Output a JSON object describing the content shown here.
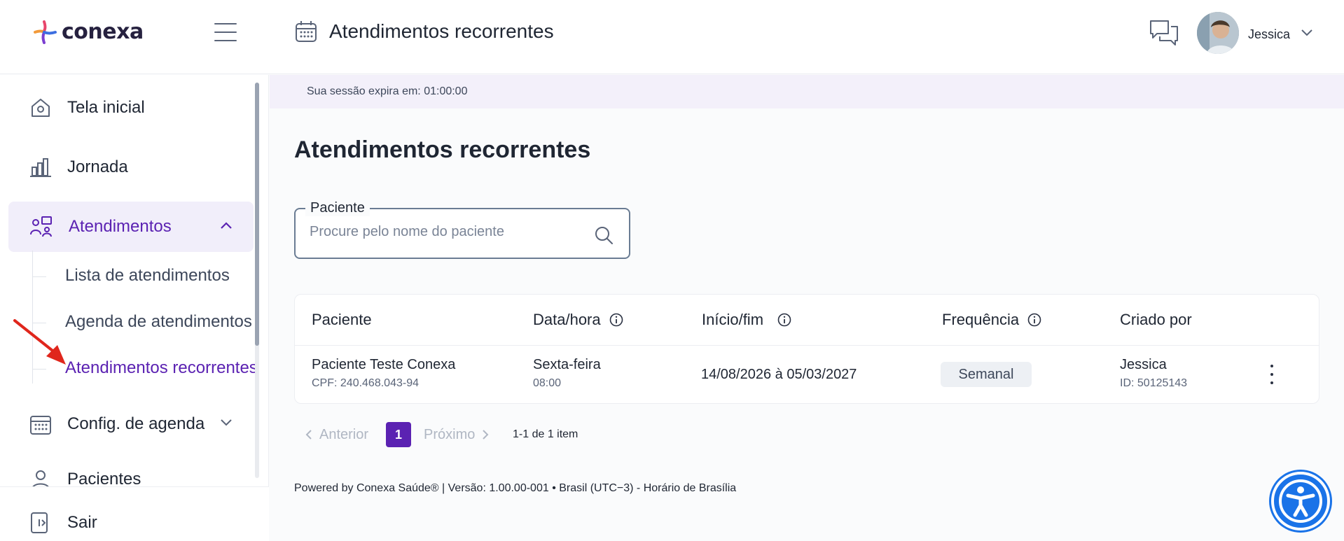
{
  "header": {
    "logo_text": "conexa",
    "title": "Atendimentos recorrentes",
    "user_name": "Jessica"
  },
  "sidebar": {
    "items": [
      {
        "label": "Tela inicial",
        "icon": "home-icon"
      },
      {
        "label": "Jornada",
        "icon": "chart-bars-icon"
      },
      {
        "label": "Atendimentos",
        "icon": "people-monitor-icon",
        "expanded": true
      },
      {
        "label": "Config. de agenda",
        "icon": "calendar-icon",
        "expanded": false
      },
      {
        "label": "Pacientes",
        "icon": "user-icon"
      }
    ],
    "subitems": [
      {
        "label": "Lista de atendimentos"
      },
      {
        "label": "Agenda de atendimentos"
      },
      {
        "label": "Atendimentos recorrentes",
        "active": true
      }
    ],
    "logout_label": "Sair"
  },
  "session": {
    "text": "Sua sessão expira em: 01:00:00"
  },
  "main": {
    "page_title": "Atendimentos recorrentes",
    "search": {
      "label": "Paciente",
      "placeholder": "Procure pelo nome do paciente",
      "value": ""
    },
    "table": {
      "columns": [
        "Paciente",
        "Data/hora",
        "Início/fim",
        "Frequência",
        "Criado por"
      ],
      "rows": [
        {
          "patient_name": "Paciente Teste Conexa",
          "patient_cpf": "CPF: 240.468.043-94",
          "day": "Sexta-feira",
          "time": "08:00",
          "period": "14/08/2026 à 05/03/2027",
          "frequency": "Semanal",
          "created_by": "Jessica",
          "created_by_id": "ID: 50125143"
        }
      ]
    },
    "pagination": {
      "prev_label": "Anterior",
      "current_page": "1",
      "next_label": "Próximo",
      "count_text": "1-1 de 1 item"
    },
    "footer": "Powered by Conexa Saúde® | Versão: 1.00.00-001 • Brasil (UTC−3) - Horário de Brasília"
  },
  "colors": {
    "brand_purple": "#5b22b2",
    "active_bg": "#f1eefa",
    "session_bg": "#f3f0fa",
    "a11y_blue": "#1a73e8",
    "arrow_red": "#e0261c"
  }
}
